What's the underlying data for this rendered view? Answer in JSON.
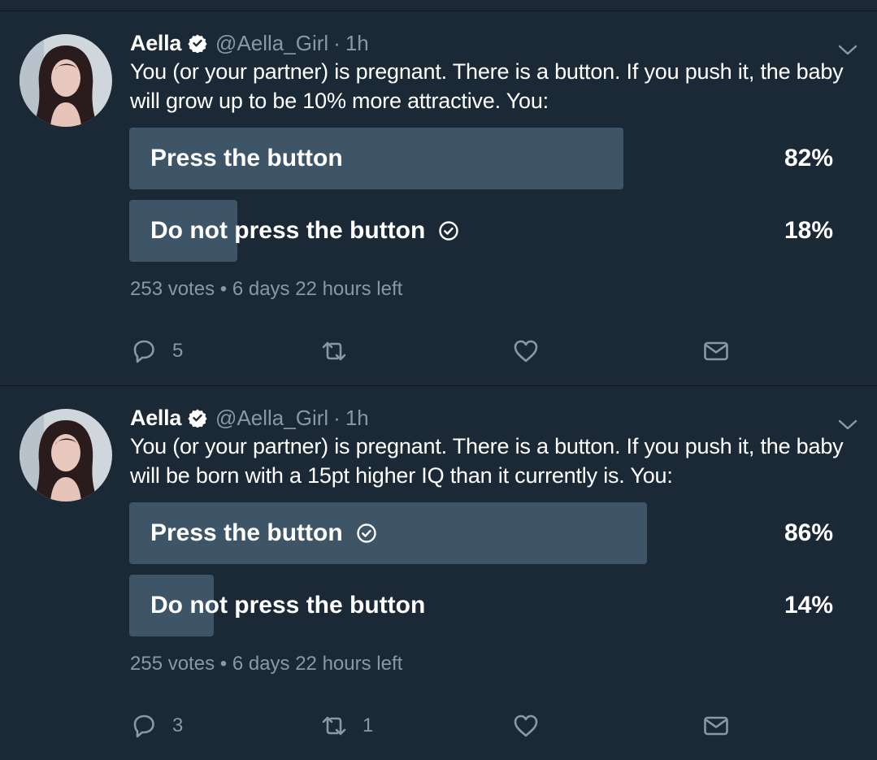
{
  "colors": {
    "background": "#1b2836",
    "bar": "#3e5568",
    "muted": "#8899a6",
    "text": "#ffffff"
  },
  "tweets": [
    {
      "name": "Aella",
      "handle": "@Aella_Girl",
      "separator": "·",
      "time": "1h",
      "text": "You (or your partner) is pregnant. There is a button. If you push it, the baby will grow up to be 10% more attractive. You:",
      "poll": {
        "choices": [
          {
            "label": "Press the button",
            "percent": "82%",
            "fraction": 0.82,
            "selected": false
          },
          {
            "label": "Do not press the button",
            "percent": "18%",
            "fraction": 0.18,
            "selected": true
          }
        ],
        "votes": "253 votes",
        "meta_separator": "•",
        "time_left": "6 days 22 hours left"
      },
      "actions": {
        "replies": "5",
        "retweets": "",
        "likes": ""
      }
    },
    {
      "name": "Aella",
      "handle": "@Aella_Girl",
      "separator": "·",
      "time": "1h",
      "text": "You (or your partner) is pregnant. There is a button. If you push it, the baby will be born with a 15pt higher IQ than it currently is. You:",
      "poll": {
        "choices": [
          {
            "label": "Press the button",
            "percent": "86%",
            "fraction": 0.86,
            "selected": true
          },
          {
            "label": "Do not press the button",
            "percent": "14%",
            "fraction": 0.14,
            "selected": false
          }
        ],
        "votes": "255 votes",
        "meta_separator": "•",
        "time_left": "6 days 22 hours left"
      },
      "actions": {
        "replies": "3",
        "retweets": "1",
        "likes": ""
      }
    }
  ],
  "icons": {
    "verified": "verified-badge-icon",
    "chevron": "chevron-down-icon",
    "reply": "reply-bubble-icon",
    "retweet": "retweet-icon",
    "like": "heart-icon",
    "dm": "envelope-icon",
    "selected": "check-circle-icon"
  }
}
